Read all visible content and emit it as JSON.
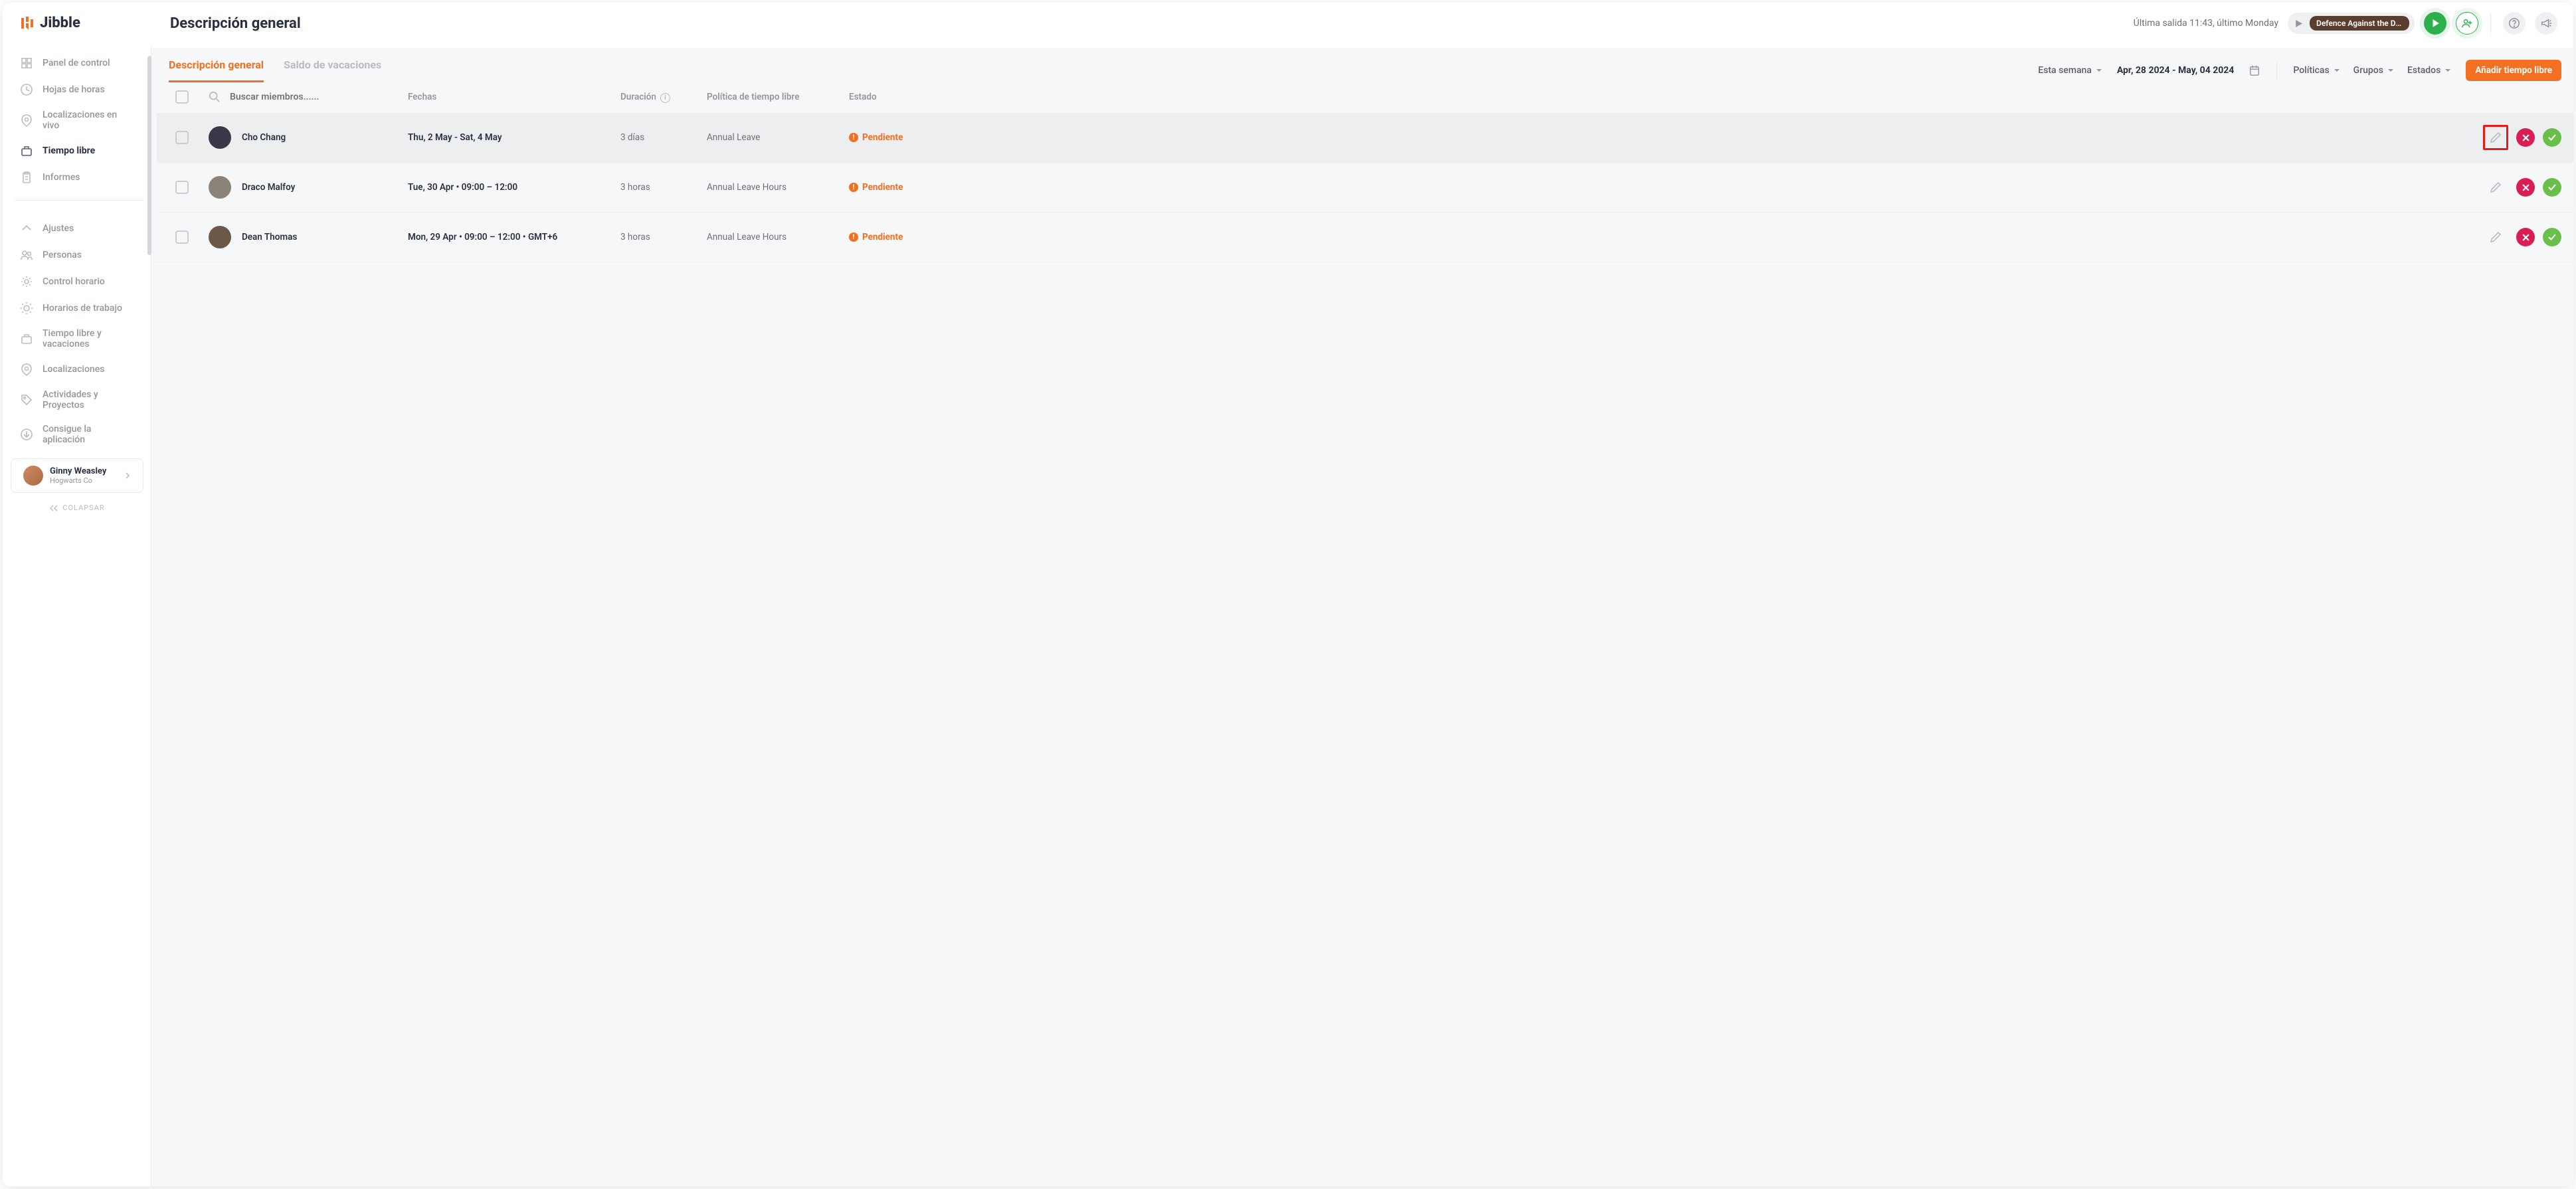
{
  "logo_text": "Jibble",
  "nav": {
    "main": [
      {
        "label": "Panel de control",
        "icon": "dashboard",
        "active": false
      },
      {
        "label": "Hojas de horas",
        "icon": "clock",
        "active": false
      },
      {
        "label": "Localizaciones en vivo",
        "icon": "location",
        "active": false
      },
      {
        "label": "Tiempo libre",
        "icon": "briefcase",
        "active": true
      },
      {
        "label": "Informes",
        "icon": "clipboard",
        "active": false
      }
    ],
    "secondary": [
      {
        "label": "Ajustes",
        "icon": "chevron-up"
      },
      {
        "label": "Personas",
        "icon": "people"
      },
      {
        "label": "Control horario",
        "icon": "gear"
      },
      {
        "label": "Horarios de trabajo",
        "icon": "sun"
      },
      {
        "label": "Tiempo libre y vacaciones",
        "icon": "briefcase"
      },
      {
        "label": "Localizaciones",
        "icon": "location"
      },
      {
        "label": "Actividades y Proyectos",
        "icon": "tag"
      },
      {
        "label": "Consigue la aplicación",
        "icon": "download"
      }
    ]
  },
  "user": {
    "name": "Ginny Weasley",
    "org": "Hogwarts Co"
  },
  "collapse": "COLAPSAR",
  "header": {
    "title": "Descripción general",
    "status": "Última salida 11:43, último Monday",
    "tag": "Defence Against the Da..."
  },
  "tabs": [
    {
      "label": "Descripción general",
      "active": true
    },
    {
      "label": "Saldo de vacaciones",
      "active": false
    }
  ],
  "range_label": "Esta semana",
  "date_range": "Apr, 28 2024 - May, 04 2024",
  "filters": [
    "Políticas",
    "Grupos",
    "Estados"
  ],
  "add_btn": "Añadir tiempo libre",
  "table": {
    "search_placeholder": "Buscar miembros......",
    "headers": {
      "dates": "Fechas",
      "duration": "Duración",
      "policy": "Política de tiempo libre",
      "status": "Estado"
    },
    "rows": [
      {
        "name": "Cho Chang",
        "avatar": "#3b3648",
        "dates": "Thu, 2 May - Sat, 4 May",
        "duration": "3 días",
        "policy": "Annual Leave",
        "status": "Pendiente",
        "highlighted": true,
        "edit_boxed": true
      },
      {
        "name": "Draco Malfoy",
        "avatar": "#8b8278",
        "dates": "Tue, 30 Apr • 09:00 – 12:00",
        "duration": "3 horas",
        "policy": "Annual Leave Hours",
        "status": "Pendiente",
        "highlighted": false,
        "edit_boxed": false
      },
      {
        "name": "Dean Thomas",
        "avatar": "#6b5847",
        "dates": "Mon, 29 Apr • 09:00 – 12:00 • GMT+6",
        "duration": "3 horas",
        "policy": "Annual Leave Hours",
        "status": "Pendiente",
        "highlighted": false,
        "edit_boxed": false
      }
    ]
  }
}
